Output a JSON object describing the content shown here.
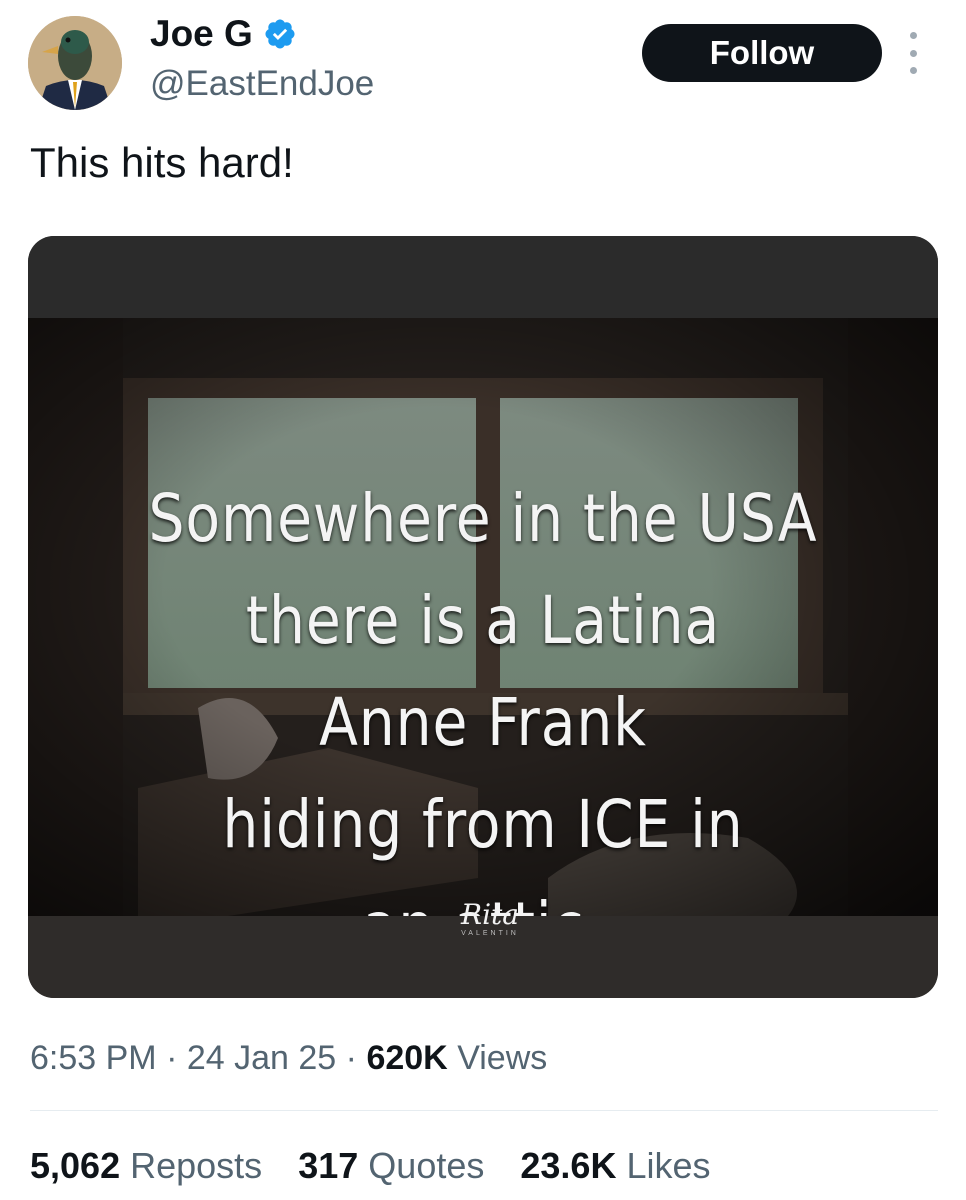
{
  "author": {
    "display_name": "Joe G",
    "handle": "@EastEndJoe",
    "verified_icon": "verified-badge-icon",
    "verified_color": "#1d9bf0"
  },
  "follow_label": "Follow",
  "tweet_text": "This hits hard!",
  "media": {
    "caption_lines": [
      "Somewhere in the USA",
      "there is a Latina",
      "Anne Frank",
      "hiding from ICE in",
      "an attic."
    ],
    "signature": "Rita",
    "signature_sub": "VALENTIN"
  },
  "meta": {
    "time": "6:53 PM",
    "separator": "·",
    "date": "24 Jan 25",
    "views_count": "620K",
    "views_label": "Views"
  },
  "stats": {
    "reposts_count": "5,062",
    "reposts_label": "Reposts",
    "quotes_count": "317",
    "quotes_label": "Quotes",
    "likes_count": "23.6K",
    "likes_label": "Likes"
  },
  "colors": {
    "text_primary": "#0f1419",
    "text_secondary": "#536471",
    "button_bg": "#0f1419"
  }
}
